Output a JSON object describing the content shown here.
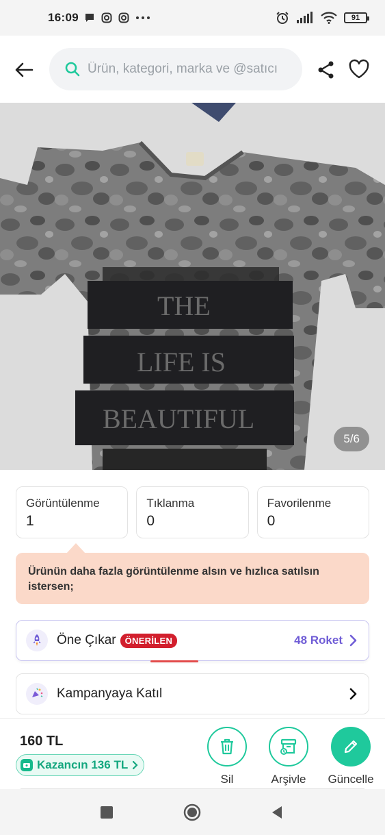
{
  "status_bar": {
    "time": "16:09",
    "battery": "91"
  },
  "search": {
    "placeholder": "Ürün, kategori, marka ve @satıcı"
  },
  "gallery": {
    "counter": "5/6"
  },
  "stats": [
    {
      "label": "Görüntülenme",
      "value": "1"
    },
    {
      "label": "Tıklanma",
      "value": "0"
    },
    {
      "label": "Favorilenme",
      "value": "0"
    }
  ],
  "info": {
    "text": "Ürünün daha fazla görüntülenme alsın ve hızlıca satılsın istersen;"
  },
  "boost": {
    "title": "Öne Çıkar",
    "badge": "ÖNERİLEN",
    "price": "48 Roket"
  },
  "campaign": {
    "title": "Kampanyaya Katıl"
  },
  "bottom": {
    "price": "160 TL",
    "earn": "Kazancın 136 TL",
    "delete_label": "Sil",
    "archive_label": "Arşivle",
    "update_label": "Güncelle"
  },
  "colors": {
    "accent_green": "#1fc99c",
    "info_bg": "#fbd9c9",
    "badge_red": "#d21f2d",
    "roket_purple": "#6f5cd6"
  },
  "icons": [
    "chat-icon",
    "instagram-icon",
    "more-icon",
    "alarm-icon",
    "signal-icon",
    "wifi-icon",
    "battery-icon",
    "back-arrow-icon",
    "search-icon",
    "share-icon",
    "heart-icon",
    "rocket-icon",
    "campaign-icon",
    "chevron-right-icon",
    "wallet-icon",
    "trash-icon",
    "archive-icon",
    "pencil-icon",
    "square-nav-icon",
    "home-nav-icon",
    "back-nav-icon"
  ]
}
